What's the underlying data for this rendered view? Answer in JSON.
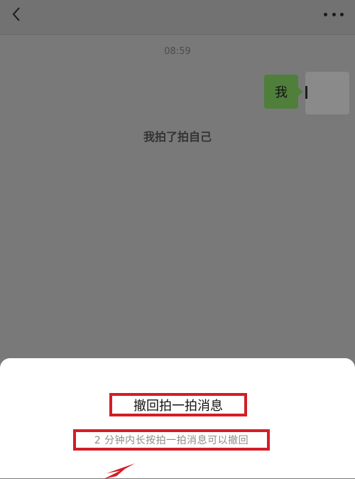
{
  "header": {
    "back_icon": "chevron-left-icon",
    "more_icon": "ellipsis-icon"
  },
  "chat": {
    "time": "08:59",
    "bubble_text": "我",
    "system_message": "我拍了拍自己"
  },
  "sheet": {
    "title": "撤回拍一拍消息",
    "hint": "2 分钟内长按拍一拍消息可以撤回"
  },
  "colors": {
    "overlay": "#7a7a7a",
    "bubble": "#4f7f3b",
    "highlight": "#d31d26",
    "sheet": "#ffffff"
  }
}
